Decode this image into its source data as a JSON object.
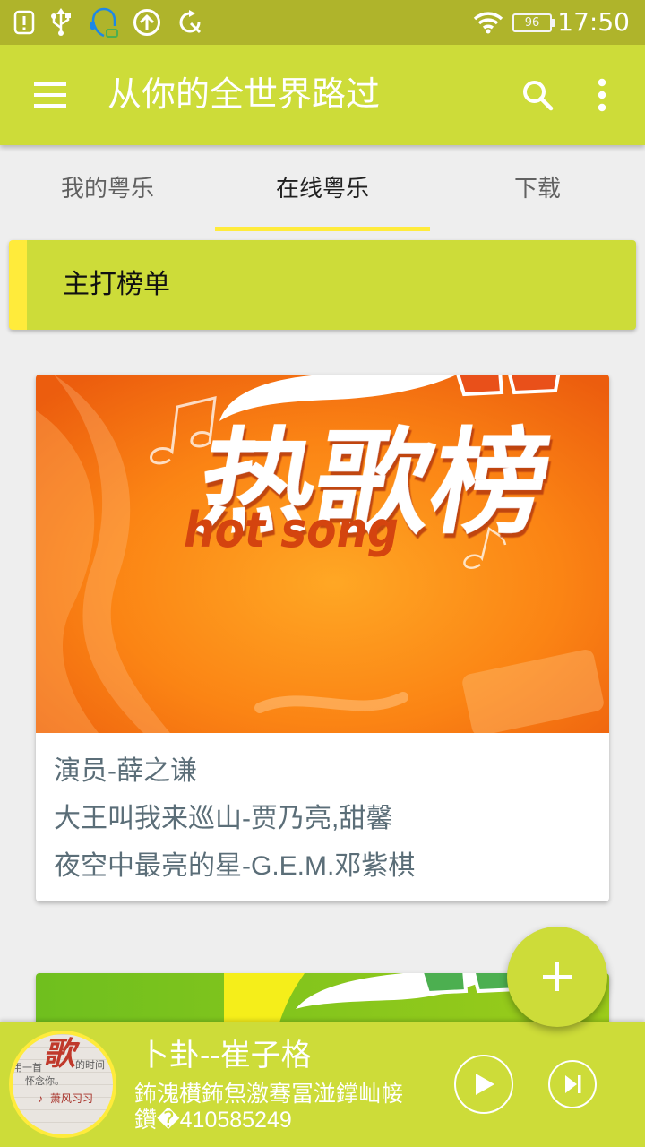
{
  "status_bar": {
    "left_icons": [
      "alert-icon",
      "usb-icon",
      "headset-icon",
      "upload-icon",
      "sync-off-icon"
    ],
    "right_icons": [
      "wifi-icon",
      "battery-icon"
    ],
    "battery": "96",
    "time": "17:50"
  },
  "app_bar": {
    "title": "从你的全世界路过",
    "menu_icon": "menu-icon",
    "actions": [
      "search-icon",
      "more-vert-icon"
    ]
  },
  "tabs": [
    {
      "label": "我的粤乐",
      "selected": false
    },
    {
      "label": "在线粤乐",
      "selected": true
    },
    {
      "label": "下载",
      "selected": false
    }
  ],
  "section": {
    "title": "主打榜单"
  },
  "playlists": [
    {
      "cover_lettering": {
        "title": "热歌榜",
        "subtitle": "hot song"
      },
      "songs": [
        "演员-薛之谦",
        "大王叫我来巡山-贾乃亮,甜馨",
        "夜空中最亮的星-G.E.M.邓紫棋"
      ]
    }
  ],
  "fab": {
    "icon": "add-icon"
  },
  "now_playing": {
    "title": "卜卦--崔子格",
    "subtitle_lines": [
      "鈽溾櫕鈽炰激骞冨湴鐣屾帹",
      "鑽�410585249"
    ],
    "album_art_lettering": [
      "用一首",
      "歌",
      "的时间",
      "怀念你。",
      "萧风习习"
    ],
    "controls": [
      "play-icon",
      "skip-next-icon"
    ]
  },
  "colors": {
    "primary": "#cddc39",
    "primary_dark": "#afb42b",
    "accent": "#ffeb3b",
    "song_text": "#5b6e78",
    "cover_orange": "#fb8414",
    "cover_green": "#7cc21f"
  }
}
